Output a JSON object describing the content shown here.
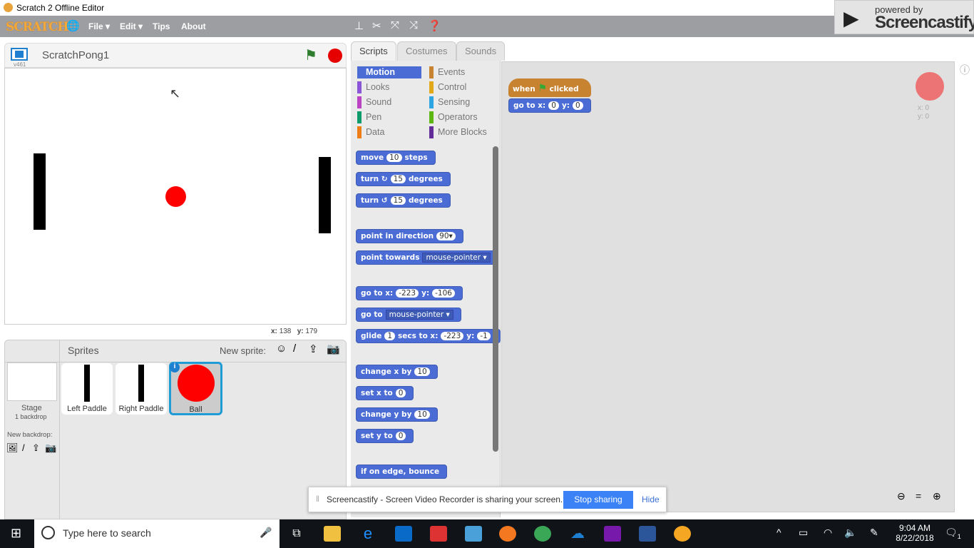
{
  "window": {
    "title": "Scratch 2 Offline Editor"
  },
  "menubar": {
    "logo": "SCRATCH",
    "file": "File ▾",
    "edit": "Edit ▾",
    "tips": "Tips",
    "about": "About"
  },
  "screencastify_brand": {
    "powered": "powered by",
    "name": "Screencastify"
  },
  "stage": {
    "project_name": "ScratchPong1",
    "version": "v461",
    "mouse_x_label": "x:",
    "mouse_x": "138",
    "mouse_y_label": "y:",
    "mouse_y": "179"
  },
  "sprites_pane": {
    "title": "Sprites",
    "new_sprite": "New sprite:",
    "stage_label": "Stage",
    "backdrops": "1 backdrop",
    "new_backdrop": "New backdrop:",
    "sprites": [
      {
        "name": "Left Paddle"
      },
      {
        "name": "Right Paddle"
      },
      {
        "name": "Ball",
        "selected": true
      }
    ]
  },
  "tabs": [
    {
      "label": "Scripts",
      "active": true
    },
    {
      "label": "Costumes"
    },
    {
      "label": "Sounds"
    }
  ],
  "categories": [
    {
      "label": "Motion",
      "color": "#4a6cd4",
      "active": true
    },
    {
      "label": "Events",
      "color": "#c88330"
    },
    {
      "label": "Looks",
      "color": "#8a55d7"
    },
    {
      "label": "Control",
      "color": "#e1a91a"
    },
    {
      "label": "Sound",
      "color": "#bb42c3"
    },
    {
      "label": "Sensing",
      "color": "#2ca5e2"
    },
    {
      "label": "Pen",
      "color": "#0e9a6c"
    },
    {
      "label": "Operators",
      "color": "#5cb712"
    },
    {
      "label": "Data",
      "color": "#ee7d16"
    },
    {
      "label": "More Blocks",
      "color": "#632d99"
    }
  ],
  "blocks": [
    [
      [
        "t",
        "move"
      ],
      [
        "i",
        "10"
      ],
      [
        "t",
        "steps"
      ]
    ],
    [
      [
        "t",
        "turn ↻"
      ],
      [
        "i",
        "15"
      ],
      [
        "t",
        "degrees"
      ]
    ],
    [
      [
        "t",
        "turn ↺"
      ],
      [
        "i",
        "15"
      ],
      [
        "t",
        "degrees"
      ]
    ],
    [
      [
        "t",
        "point in direction"
      ],
      [
        "i",
        "90▾"
      ]
    ],
    [
      [
        "t",
        "point towards"
      ],
      [
        "d",
        "mouse-pointer ▾"
      ]
    ],
    [
      [
        "t",
        "go to x:"
      ],
      [
        "i",
        "-223"
      ],
      [
        "t",
        "y:"
      ],
      [
        "i",
        "-106"
      ]
    ],
    [
      [
        "t",
        "go to"
      ],
      [
        "d",
        "mouse-pointer ▾"
      ]
    ],
    [
      [
        "t",
        "glide"
      ],
      [
        "i",
        "1"
      ],
      [
        "t",
        "secs to x:"
      ],
      [
        "i",
        "-223"
      ],
      [
        "t",
        "y:"
      ],
      [
        "i",
        "-1"
      ]
    ],
    [
      [
        "t",
        "change x by"
      ],
      [
        "i",
        "10"
      ]
    ],
    [
      [
        "t",
        "set x to"
      ],
      [
        "i",
        "0"
      ]
    ],
    [
      [
        "t",
        "change y by"
      ],
      [
        "i",
        "10"
      ]
    ],
    [
      [
        "t",
        "set y to"
      ],
      [
        "i",
        "0"
      ]
    ],
    [
      [
        "t",
        "if on edge, bounce"
      ]
    ]
  ],
  "script": {
    "hat_when": "when",
    "hat_clicked": "clicked",
    "goto": "go to x:",
    "x": "0",
    "y_label": "y:",
    "y": "0"
  },
  "sprite_info": {
    "x": "x: 0",
    "y": "y: 0"
  },
  "share_bar": {
    "text": "Screencastify - Screen Video Recorder is sharing your screen.",
    "stop": "Stop sharing",
    "hide": "Hide"
  },
  "taskbar": {
    "search_placeholder": "Type here to search",
    "time": "9:04 AM",
    "date": "8/22/2018",
    "notifications": "1"
  },
  "colors": {
    "motion": "#4a6cd4",
    "events": "#c88330",
    "ball": "#ff0000",
    "share_button": "#3b82f6"
  }
}
